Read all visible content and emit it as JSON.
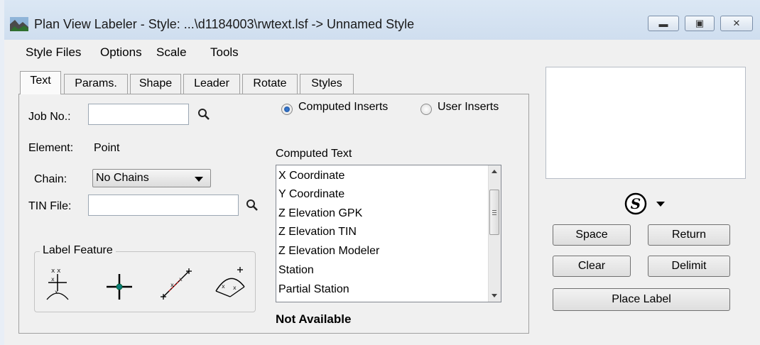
{
  "window": {
    "title": "Plan View Labeler - Style: ...\\d1184003\\rwtext.lsf -> Unnamed Style",
    "controls": [
      "minimize",
      "maximize",
      "close"
    ]
  },
  "menubar": {
    "items": [
      "Style Files",
      "Options",
      "Scale",
      "Tools"
    ]
  },
  "tabs": [
    "Text",
    "Params.",
    "Shape",
    "Leader",
    "Rotate",
    "Styles"
  ],
  "active_tab": "Text",
  "text_tab": {
    "job_no_label": "Job No.:",
    "job_no_value": "",
    "element_label": "Element:",
    "element_value": "Point",
    "chain_label": "Chain:",
    "chain_value": "No Chains",
    "tin_label": "TIN File:",
    "tin_value": "",
    "label_feature_title": "Label Feature",
    "inserts": {
      "computed_label": "Computed Inserts",
      "user_label": "User Inserts",
      "selected": "Computed Inserts"
    },
    "computed_text_label": "Computed Text",
    "computed_items": [
      "X Coordinate",
      "Y Coordinate",
      "Z Elevation GPK",
      "Z Elevation TIN",
      "Z Elevation Modeler",
      "Station",
      "Partial Station"
    ],
    "status": "Not Available"
  },
  "buttons": {
    "space": "Space",
    "return": "Return",
    "clear": "Clear",
    "delimit": "Delimit",
    "place_label": "Place Label"
  },
  "symbol_icon": "S"
}
